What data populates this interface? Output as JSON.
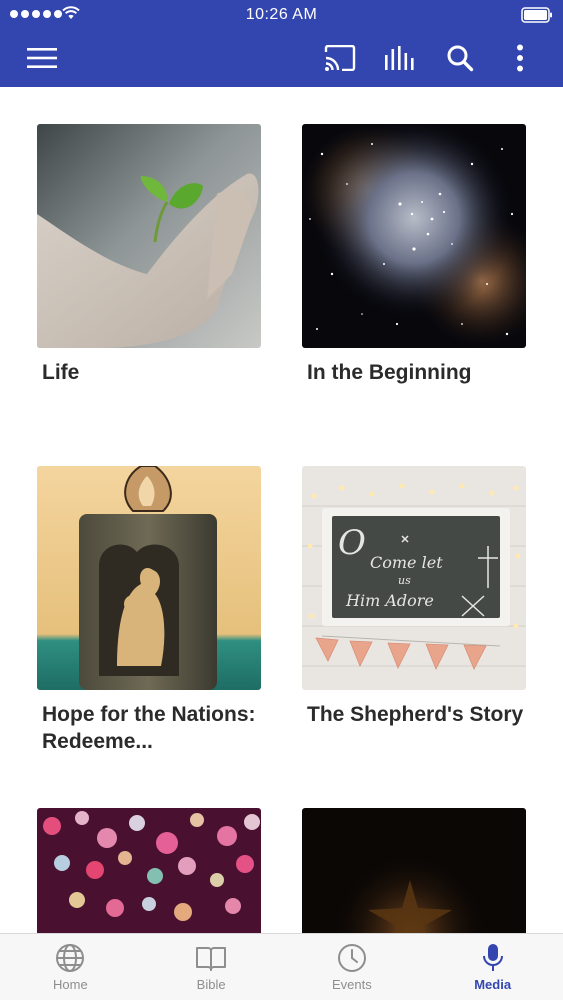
{
  "status_bar": {
    "time": "10:26 AM"
  },
  "app_bar": {
    "icons": [
      "menu-icon",
      "cast-icon",
      "equalizer-icon",
      "search-icon",
      "more-vertical-icon"
    ],
    "color": "#3346b0"
  },
  "media": {
    "items": [
      {
        "title": "Life",
        "image": "hand-holding-sprout"
      },
      {
        "title": "In the Beginning",
        "image": "nebula-starfield"
      },
      {
        "title": "Hope for the Nations: Redeeme...",
        "image": "candle-with-couple-cutout"
      },
      {
        "title": "The Shepherd's Story",
        "image": "chalkboard-o-come-let-us-adore-him"
      },
      {
        "title": "",
        "image": "colorful-bokeh-lights"
      },
      {
        "title": "",
        "image": "dark-glowing-star"
      }
    ]
  },
  "chalkboard_text": [
    "O",
    "Come let",
    "us",
    "Him Adore"
  ],
  "tab_bar": {
    "tabs": [
      {
        "label": "Home",
        "icon": "globe-icon"
      },
      {
        "label": "Bible",
        "icon": "book-icon"
      },
      {
        "label": "Events",
        "icon": "clock-icon"
      },
      {
        "label": "Media",
        "icon": "microphone-icon"
      }
    ],
    "active": "Media",
    "active_color": "#3346b0",
    "inactive_color": "#8e8e8e"
  }
}
